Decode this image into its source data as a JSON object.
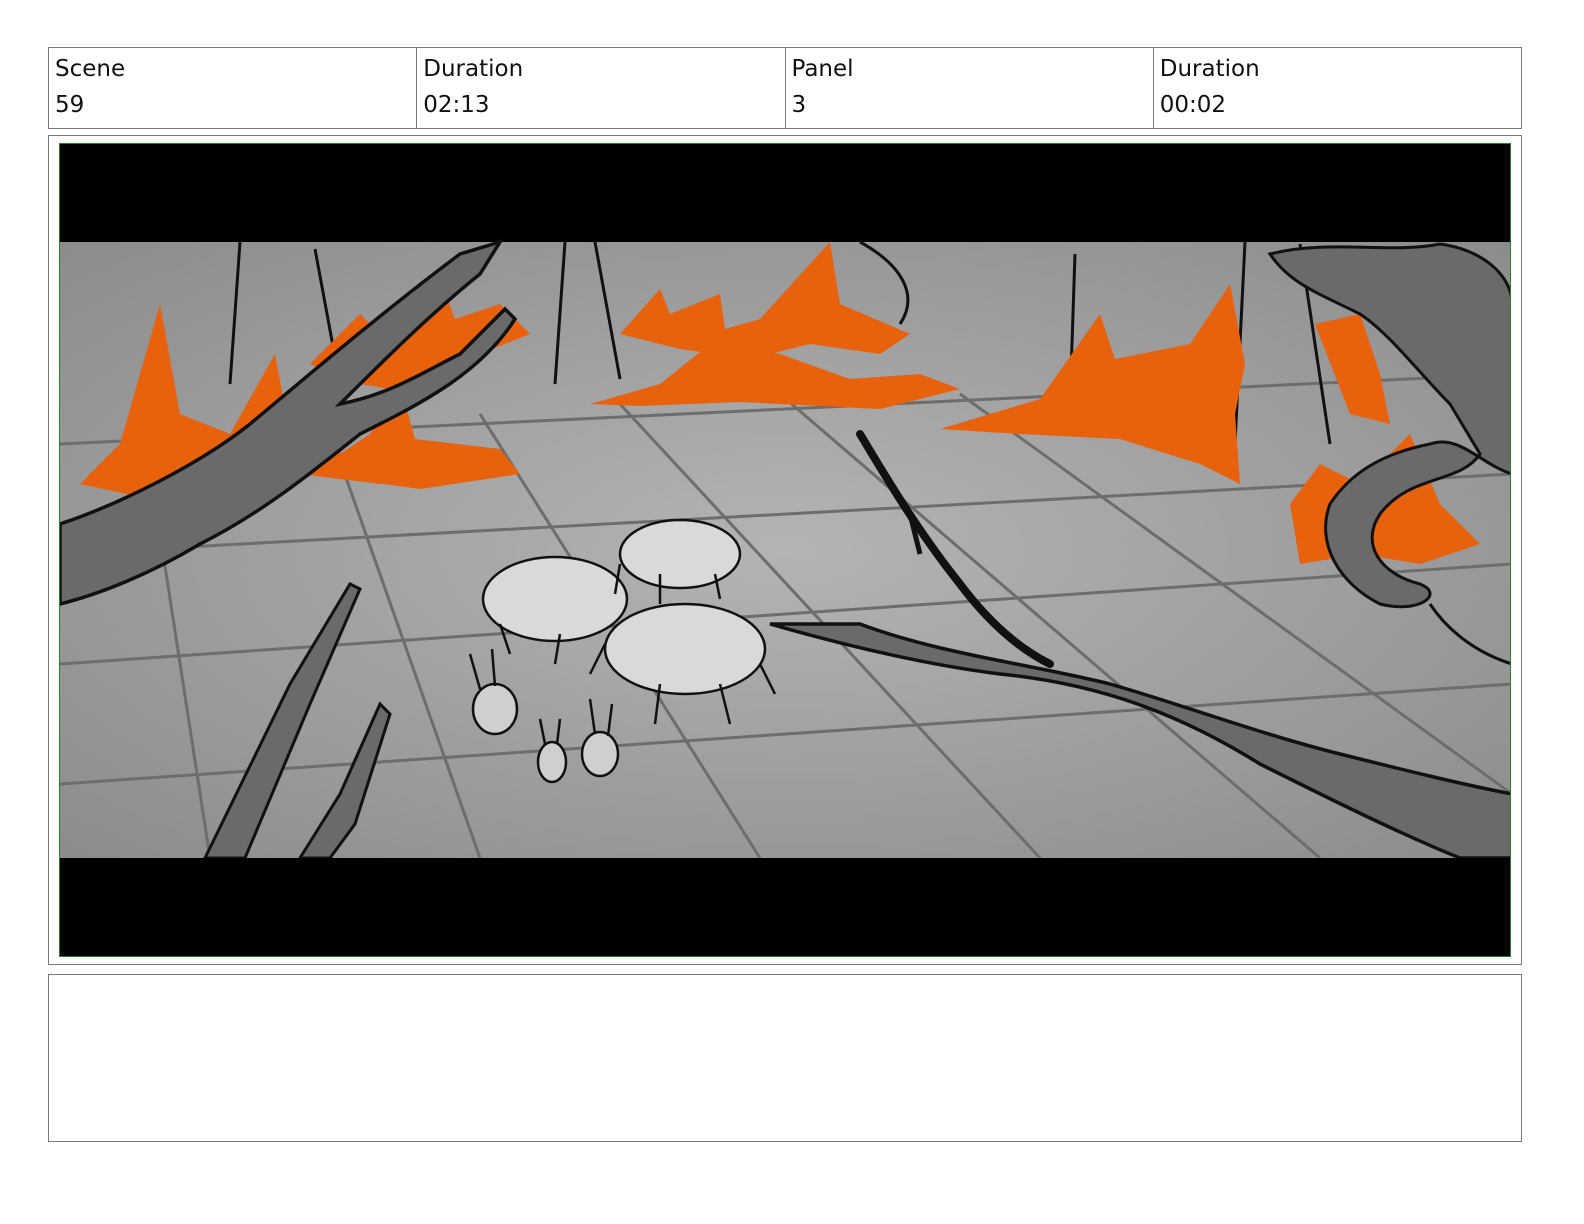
{
  "header": {
    "cells": [
      {
        "label": "Scene",
        "value": "59"
      },
      {
        "label": "Duration",
        "value": "02:13"
      },
      {
        "label": "Panel",
        "value": "3"
      },
      {
        "label": "Duration",
        "value": "00:02"
      }
    ]
  },
  "panel": {
    "colors": {
      "fire": "#e8620d",
      "ground": "#9a9a9a",
      "letterbox": "#000000",
      "frame": "#2e7d32"
    }
  },
  "notes": {
    "text": ""
  }
}
